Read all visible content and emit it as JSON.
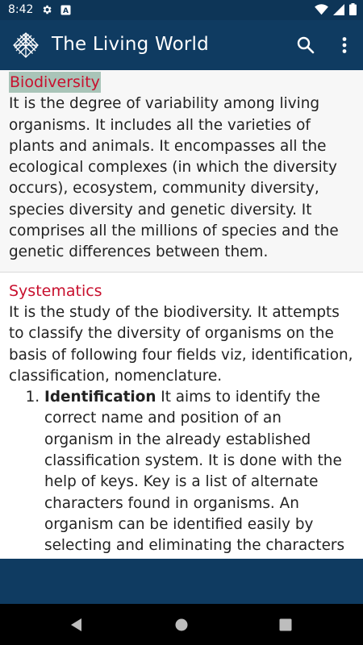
{
  "status_bar": {
    "time": "8:42",
    "icons": [
      "settings-icon",
      "keyboard-a-icon",
      "wifi-icon",
      "signal-icon",
      "battery-icon"
    ]
  },
  "app_bar": {
    "title": "The Living World",
    "icons": [
      "app-logo-icon",
      "search-icon",
      "more-vert-icon"
    ],
    "background": "#0f3b61"
  },
  "sections": [
    {
      "title": "Biodiversity",
      "body": "It is the degree of variability among living organisms. It includes all the varieties of plants and animals. It encompasses all the ecological complexes (in which the diversity occurs), ecosystem, community diversity, species diversity and genetic diversity. It comprises all the millions of species and the genetic differences between them."
    },
    {
      "title": "Systematics",
      "body": "It is the study of the biodiversity. It attempts to classify the diversity of organisms on the basis of following four fields viz, identification, classification, nomenclature.",
      "list": [
        {
          "term": "Identification",
          "text": " It aims to identify the correct name and position of an organism in the already established classification system. It is done with the help of keys. Key is a list of alternate characters found in organisms. An organism can be identified easily by selecting and eliminating the characters present in the key"
        }
      ]
    }
  ],
  "colors": {
    "title_red": "#c8102e",
    "highlight": "#a9c4b8",
    "status_bar": "#0d3557"
  },
  "nav_bar": {
    "icons": [
      "back-icon",
      "home-icon",
      "recents-icon"
    ]
  }
}
